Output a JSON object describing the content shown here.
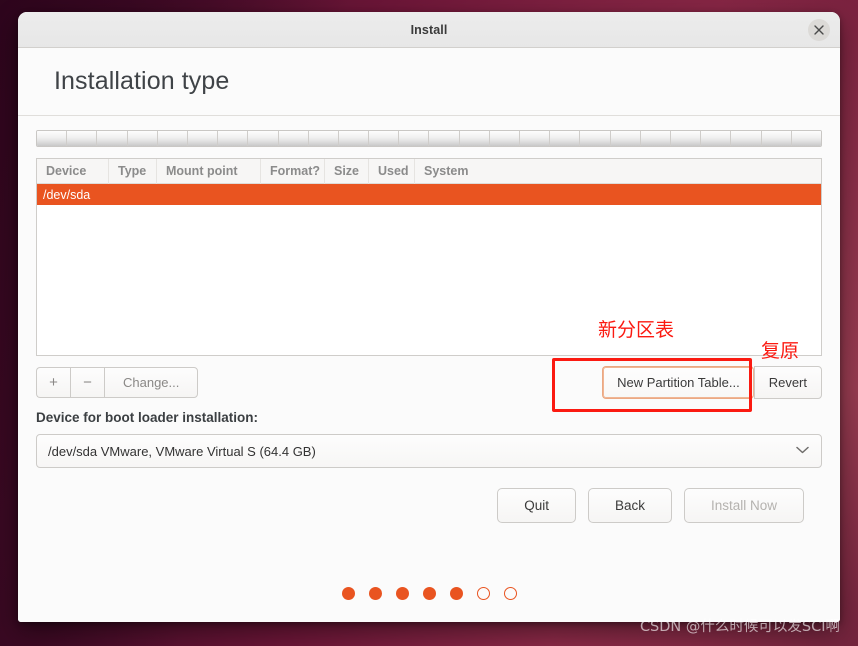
{
  "window": {
    "title": "Install",
    "close_icon": "close-icon",
    "page_title": "Installation type"
  },
  "partition_bar": {
    "segment_count": 26
  },
  "device_table": {
    "columns": [
      "Device",
      "Type",
      "Mount point",
      "Format?",
      "Size",
      "Used",
      "System"
    ],
    "rows": [
      {
        "device": "/dev/sda",
        "type": "",
        "mount_point": "",
        "format": "",
        "size": "",
        "used": "",
        "system": "",
        "selected": true
      }
    ],
    "selected_color": "#e95420"
  },
  "edit_buttons": {
    "add_label": "+",
    "remove_label": "−",
    "change_label": "Change..."
  },
  "partition_actions": {
    "new_table_label": "New Partition Table...",
    "revert_label": "Revert"
  },
  "boot_loader": {
    "label": "Device for boot loader installation:",
    "selected_value": "/dev/sda VMware, VMware Virtual S (64.4 GB)",
    "chevron_icon": "chevron-down-icon"
  },
  "footer": {
    "quit_label": "Quit",
    "back_label": "Back",
    "install_label": "Install Now",
    "install_disabled": true
  },
  "progress_dots": {
    "total": 7,
    "completed": 5
  },
  "annotations": {
    "new_table_note": "新分区表",
    "revert_note": "复原",
    "highlight_color": "#fb1a11"
  },
  "watermark": {
    "text": "CSDN @什么时候可以发SCI啊"
  }
}
